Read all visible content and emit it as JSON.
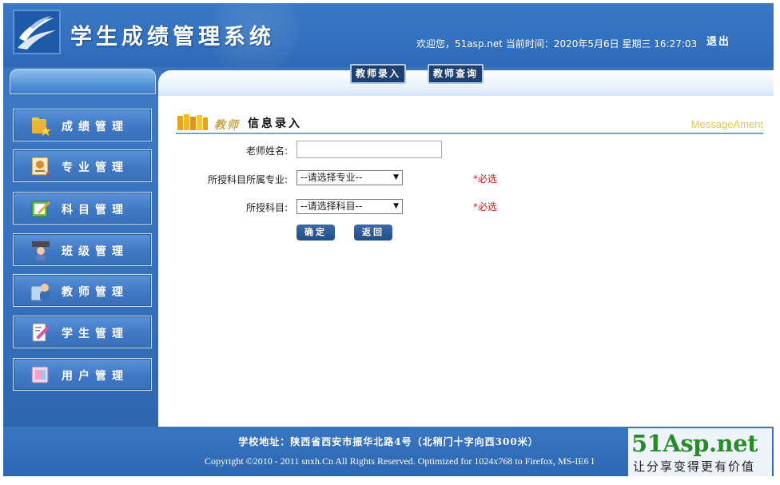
{
  "header": {
    "title": "学生成绩管理系统",
    "welcome": "欢迎您，51asp.net   当前时间：2020年5月6日 星期三 16:27:03",
    "logout_label": "退出"
  },
  "tabs": [
    {
      "label": "教师录入"
    },
    {
      "label": "教师查询"
    }
  ],
  "sidebar": {
    "items": [
      {
        "label": "成绩管理",
        "icon": "folder-star-icon"
      },
      {
        "label": "专业管理",
        "icon": "certificate-icon"
      },
      {
        "label": "科目管理",
        "icon": "edit-note-icon"
      },
      {
        "label": "班级管理",
        "icon": "class-icon"
      },
      {
        "label": "教师管理",
        "icon": "teacher-icon"
      },
      {
        "label": "学生管理",
        "icon": "student-icon"
      },
      {
        "label": "用户管理",
        "icon": "user-icon"
      }
    ]
  },
  "section": {
    "prefix": "教师",
    "title": "信息录入",
    "right_label": "MessageAment"
  },
  "form": {
    "name_label": "老师姓名:",
    "name_value": "",
    "major_label": "所授科目所属专业:",
    "major_selected": "--请选择专业--",
    "subject_label": "所授科目:",
    "subject_selected": "--请选择科目--",
    "required_text": "*必选",
    "confirm_label": "确定",
    "back_label": "返回"
  },
  "footer": {
    "address": "学校地址：陕西省西安市振华北路4号（北稍门十字向西300米）",
    "copyright": "Copyright ©2010 - 2011 snxh.Cn All Rights Reserved. Optimized for 1024x768 to Firefox, MS-IE6 I"
  },
  "watermark": {
    "logo": "51Asp.net",
    "slogan": "让分享变得更有价值"
  },
  "colors": {
    "primary": "#2f6bb6",
    "required": "#cc2222",
    "accent_gold": "#e8c84a"
  }
}
